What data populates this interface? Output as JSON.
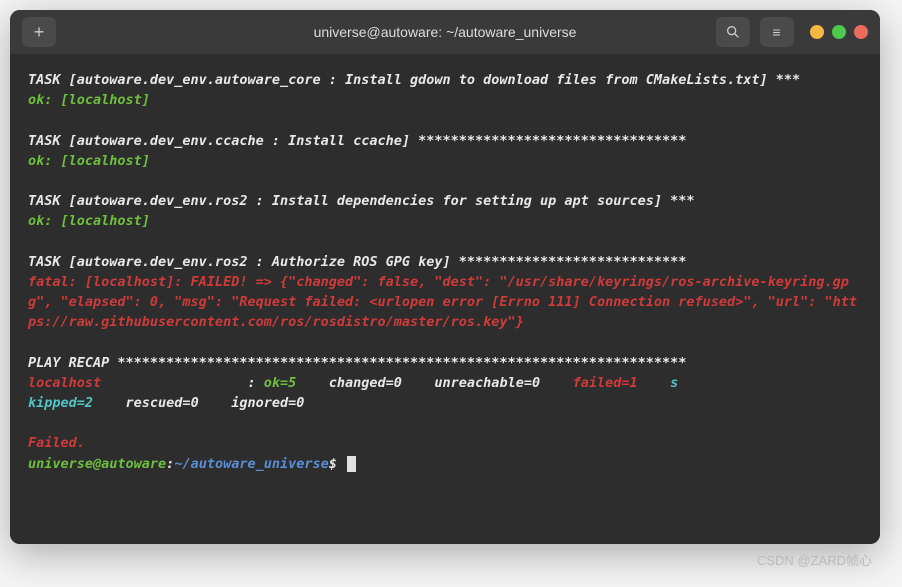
{
  "titlebar": {
    "new_tab": "+",
    "title": "universe@autoware: ~/autoware_universe",
    "menu": "≡"
  },
  "tasks": {
    "t1_header": "TASK [autoware.dev_env.autoware_core : Install gdown to download files from CMakeLists.txt] ***",
    "t1_status": "ok: [localhost]",
    "t2_header": "TASK [autoware.dev_env.ccache : Install ccache] *********************************",
    "t2_status": "ok: [localhost]",
    "t3_header": "TASK [autoware.dev_env.ros2 : Install dependencies for setting up apt sources] ***",
    "t3_status": "ok: [localhost]",
    "t4_header": "TASK [autoware.dev_env.ros2 : Authorize ROS GPG key] ****************************",
    "t4_error": "fatal: [localhost]: FAILED! => {\"changed\": false, \"dest\": \"/usr/share/keyrings/ros-archive-keyring.gpg\", \"elapsed\": 0, \"msg\": \"Request failed: <urlopen error [Errno 111] Connection refused>\", \"url\": \"https://raw.githubusercontent.com/ros/rosdistro/master/ros.key\"}"
  },
  "recap": {
    "header": "PLAY RECAP **********************************************************************",
    "host": "localhost",
    "colon": "                  : ",
    "ok": "ok=5",
    "changed": "    changed=0",
    "unreachable": "    unreachable=0",
    "failed": "    failed=1",
    "skipped_s": "    s",
    "skipped_rest": "kipped=2",
    "rescued": "    rescued=0",
    "ignored": "    ignored=0"
  },
  "footer": {
    "failed": "Failed.",
    "prompt_user": "universe@autoware",
    "prompt_colon": ":",
    "prompt_path": "~/autoware_universe",
    "prompt_dollar": "$ "
  },
  "watermark": "CSDN @ZARD帧心"
}
